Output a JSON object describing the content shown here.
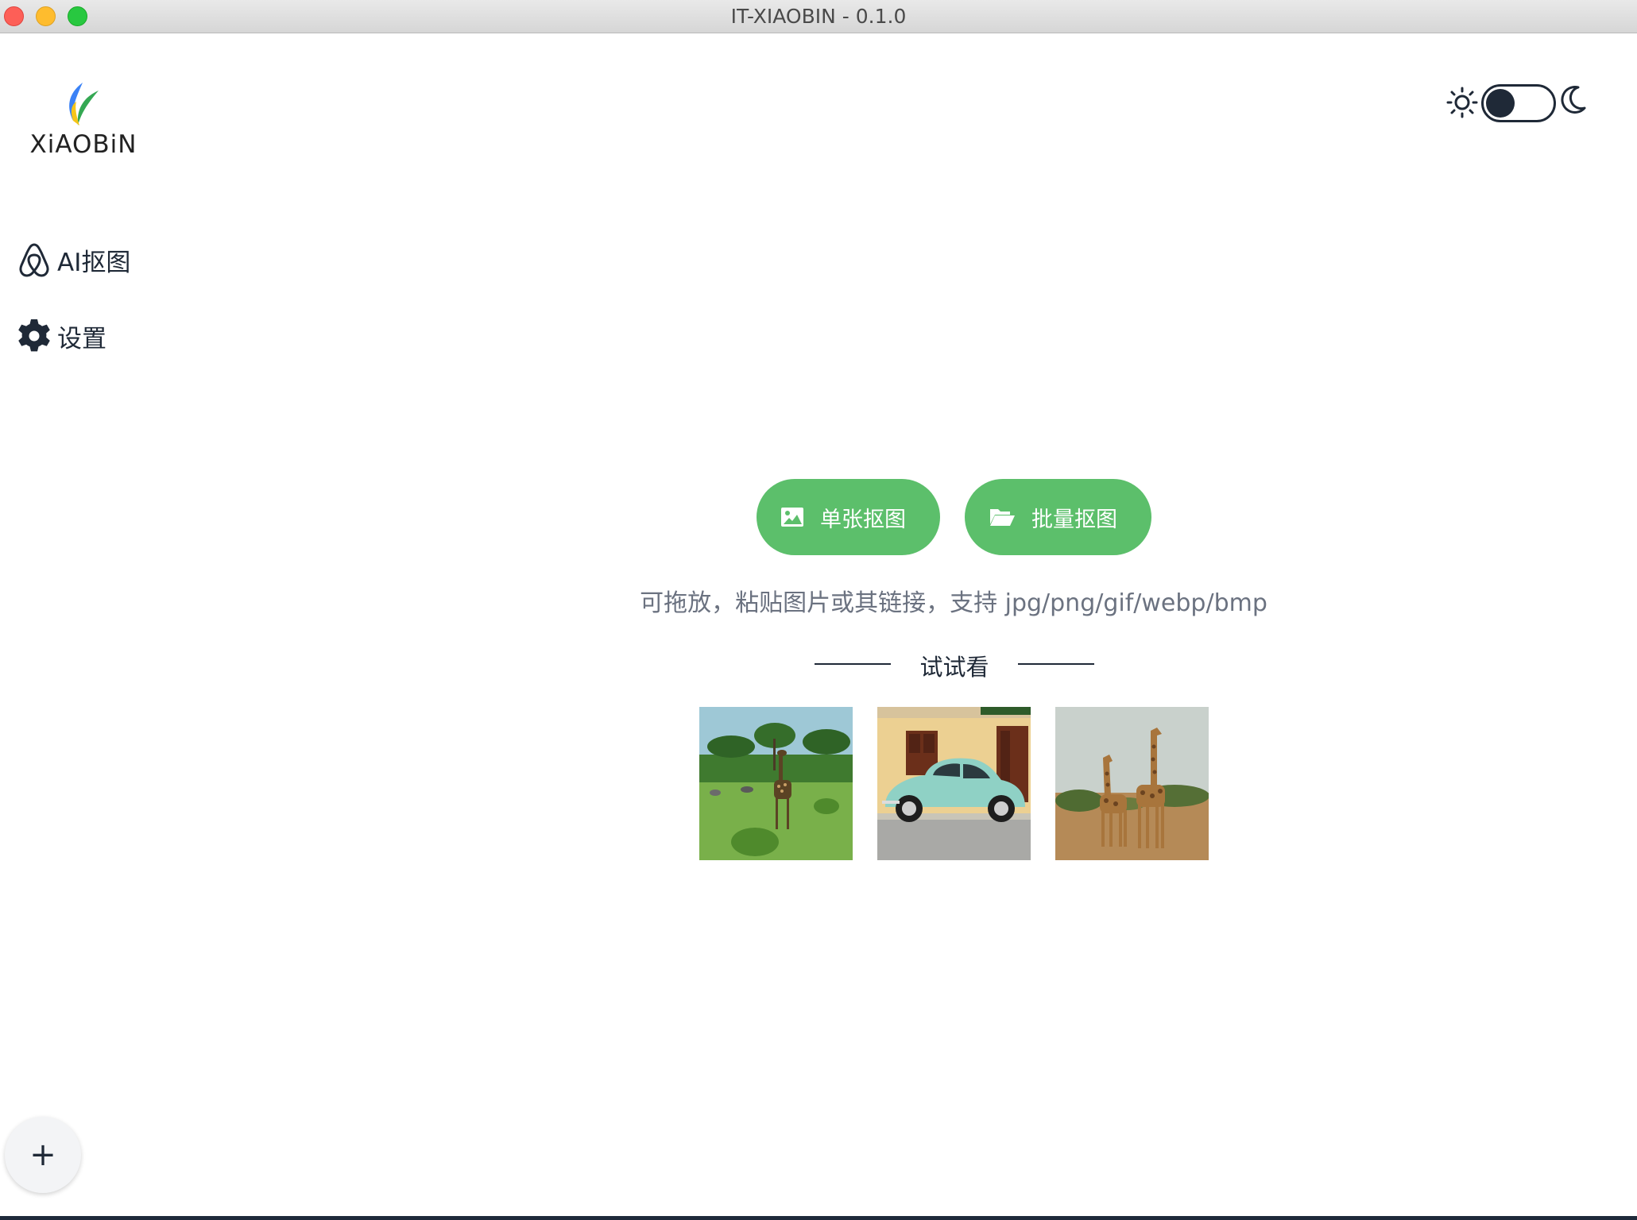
{
  "window": {
    "title": "IT-XIAOBIN - 0.1.0"
  },
  "logo": {
    "text": "XiAOBiN"
  },
  "sidebar": {
    "items": [
      {
        "label": "AI抠图",
        "icon": "airbnb-style-icon"
      },
      {
        "label": "设置",
        "icon": "gear-icon"
      }
    ]
  },
  "theme": {
    "mode": "light",
    "sun_icon": "sun-icon",
    "moon_icon": "moon-icon"
  },
  "main": {
    "single_button": "单张抠图",
    "batch_button": "批量抠图",
    "hint": "可拖放，粘贴图片或其链接，支持 jpg/png/gif/webp/bmp",
    "try_label": "试试看",
    "samples": [
      "giraffe-savanna",
      "teal-beetle-car",
      "two-giraffes"
    ]
  },
  "fab": {
    "label": "+"
  },
  "colors": {
    "accent": "#5cbf6b",
    "text": "#1f2937",
    "muted": "#6b7280"
  }
}
